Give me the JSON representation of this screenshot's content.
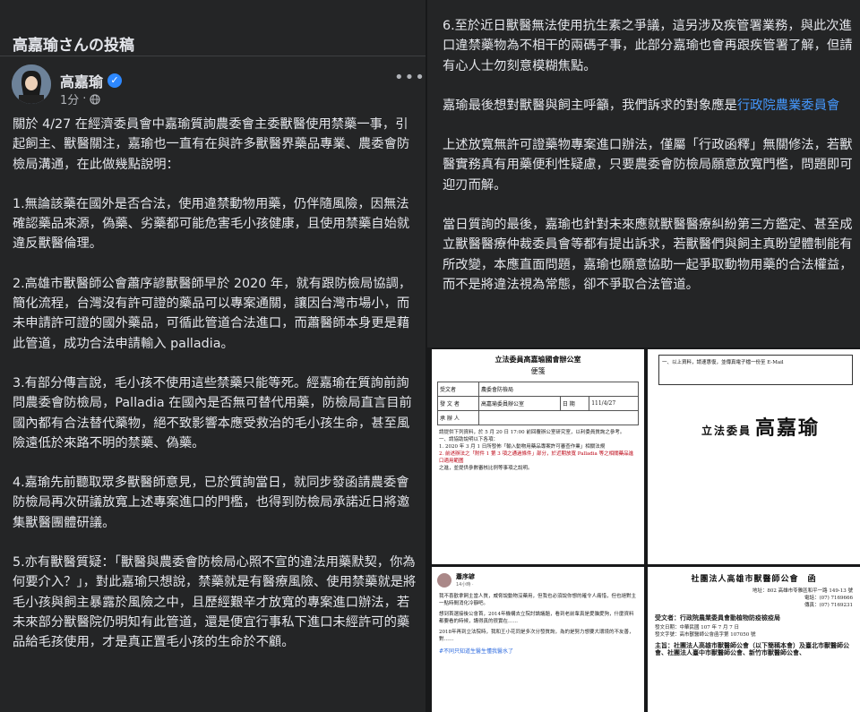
{
  "post": {
    "page_title": "高嘉瑜さんの投稿",
    "author": "高嘉瑜",
    "verified_mark": "✓",
    "time": "1分",
    "separator": "·",
    "more": "•••",
    "paragraphs": [
      "關於 4/27 在經濟委員會中嘉瑜質詢農委會主委獸醫使用禁藥一事，引起飼主、獸醫關注，嘉瑜也一直有在與許多獸醫界藥品專業、農委會防檢局溝通，在此做幾點說明：",
      "1.無論該藥在國外是否合法，使用違禁動物用藥，仍伴隨風險，因無法確認藥品來源，偽藥、劣藥都可能危害毛小孩健康，且使用禁藥自始就違反獸醫倫理。",
      "2.高雄市獸醫師公會蕭序諺獸醫師早於 2020 年，就有跟防檢局協調，簡化流程，台灣沒有許可證的藥品可以專案通關，讓因台灣市場小，而未申請許可證的國外藥品，可循此管道合法進口，而蕭醫師本身更是藉此管道，成功合法申請輸入 palladia。",
      "3.有部分傳言說，毛小孩不使用這些禁藥只能等死。經嘉瑜在質詢前詢問農委會防檢局，Palladia 在國內是否無可替代用藥，防檢局直言目前國內都有合法替代藥物，絕不致影響本應受救治的毛小孩生命，甚至風險遠低於來路不明的禁藥、偽藥。",
      "4.嘉瑜先前聽取眾多獸醫師意見，已於質詢當日，就同步發函請農委會防檢局再次研議放寬上述專案進口的門檻，也得到防檢局承諾近日將邀集獸醫團體研議。",
      "5.亦有獸醫質疑：「獸醫與農委會防檢局心照不宣的違法用藥默契，你為何要介入？」，對此嘉瑜只想說，禁藥就是有醫療風險、使用禁藥就是將毛小孩與飼主暴露於風險之中，且歷經艱辛才放寬的專案進口辦法，若未來部分獸醫院仍明知有此管道，還是便宜行事私下進口未經許可的藥品給毛孩使用，才是真正置毛小孩的生命於不顧。"
    ]
  },
  "right_text": {
    "p6": "6.至於近日獸醫無法使用抗生素之爭議，這另涉及疾管署業務，與此次進口違禁藥物為不相干的兩碼子事，此部分嘉瑜也會再跟疾管署了解，但請有心人士勿刻意模糊焦點。",
    "p7_prefix": "嘉瑜最後想對獸醫與飼主呼籲，我們訴求的對象應是",
    "p7_link": "行政院農業委員會",
    "p8": "上述放寬無許可證藥物專案進口辦法，僅屬「行政函釋」無關修法，若獸醫實務真有用藥便利性疑慮，只要農委會防檢局願意放寬門檻，問題即可迎刃而解。",
    "p9": "當日質詢的最後，嘉瑜也針對未來應就獸醫醫療糾紛第三方鑑定、甚至成立獸醫醫療仲裁委員會等都有提出訴求，若獸醫們與飼主真盼望體制能有所改變，本應直面問題，嘉瑜也願意協助一起爭取動物用藥的合法權益，而不是將違法視為常態，卻不爭取合法管道。"
  },
  "doc1": {
    "heading": "立法委員高嘉瑜國會辦公室",
    "subheading": "便箋",
    "rows": [
      [
        "受文者",
        "農委會防檢局",
        "",
        ""
      ],
      [
        "發 文 者",
        "高嘉瑜委員辦公室",
        "日 期",
        "111/4/27"
      ],
      [
        "承 辦 人",
        "",
        "",
        ""
      ]
    ],
    "body_lines": [
      "請提供下列資料，於 5 月 20 日 17:00 前回覆辦公室研究室，以利委員質詢之參考。",
      "一、請協助說明以下各項：",
      "1. 2020 年 3 月 1 日所發佈「輸入動物用藥品專案許可審查作業」相關法規",
      "2. 前述辦法之「附件 1 第 3 項之通過條件」部分，於近期放寬 Palladia 等之相關藥品進口適用範圍",
      "之進，並提供參數審核比例等事項之說明。"
    ]
  },
  "doc2": {
    "top_text": "一、以上資料，請速惠復，並傳真電子檔一份至 E-Mail",
    "sig_prefix": "立法委員",
    "signature": "高嘉瑜"
  },
  "doc3": {
    "name": "蕭序諺",
    "time": "14小時 ·",
    "lines": [
      "我不喜歡拿飼主當人質，威脅說動物沒藥用，但我也必須說你想的確令人痛惜，但也絕對主一點時間消化冷靜吧。",
      "想到首選接後公會首，2014年機構去立院討論議題，看到老前輩真是愛貓愛狗，什麼資料都要看的時候，講得真的很實在……",
      "2018年再到立法院時，我和王小花同是多次分發質詢，為的是努力想要大環境的不友善，對……"
    ],
    "hashtag": "#不同只知道生醫生懂我醫水了"
  },
  "doc4": {
    "heading": "社團法人高雄市獸醫師公會　函",
    "lines": [
      "地址：802 高雄市苓雅區和平一路 149-13 號",
      "電話：(07) 7169666",
      "傳真：(07) 7169231",
      "受文者：行政院農業委員會動植物防疫檢疫局",
      "發文日期：中華民國 107 年 7 月 7 日",
      "發文字號：高市獸醫師公會函字第 107050 號",
      "主旨：社團法人高雄市獸醫師公會（以下簡稱本會）及臺北市獸醫師公會、社團法人臺中市獸醫師公會、新竹市獸醫師公會、"
    ]
  }
}
